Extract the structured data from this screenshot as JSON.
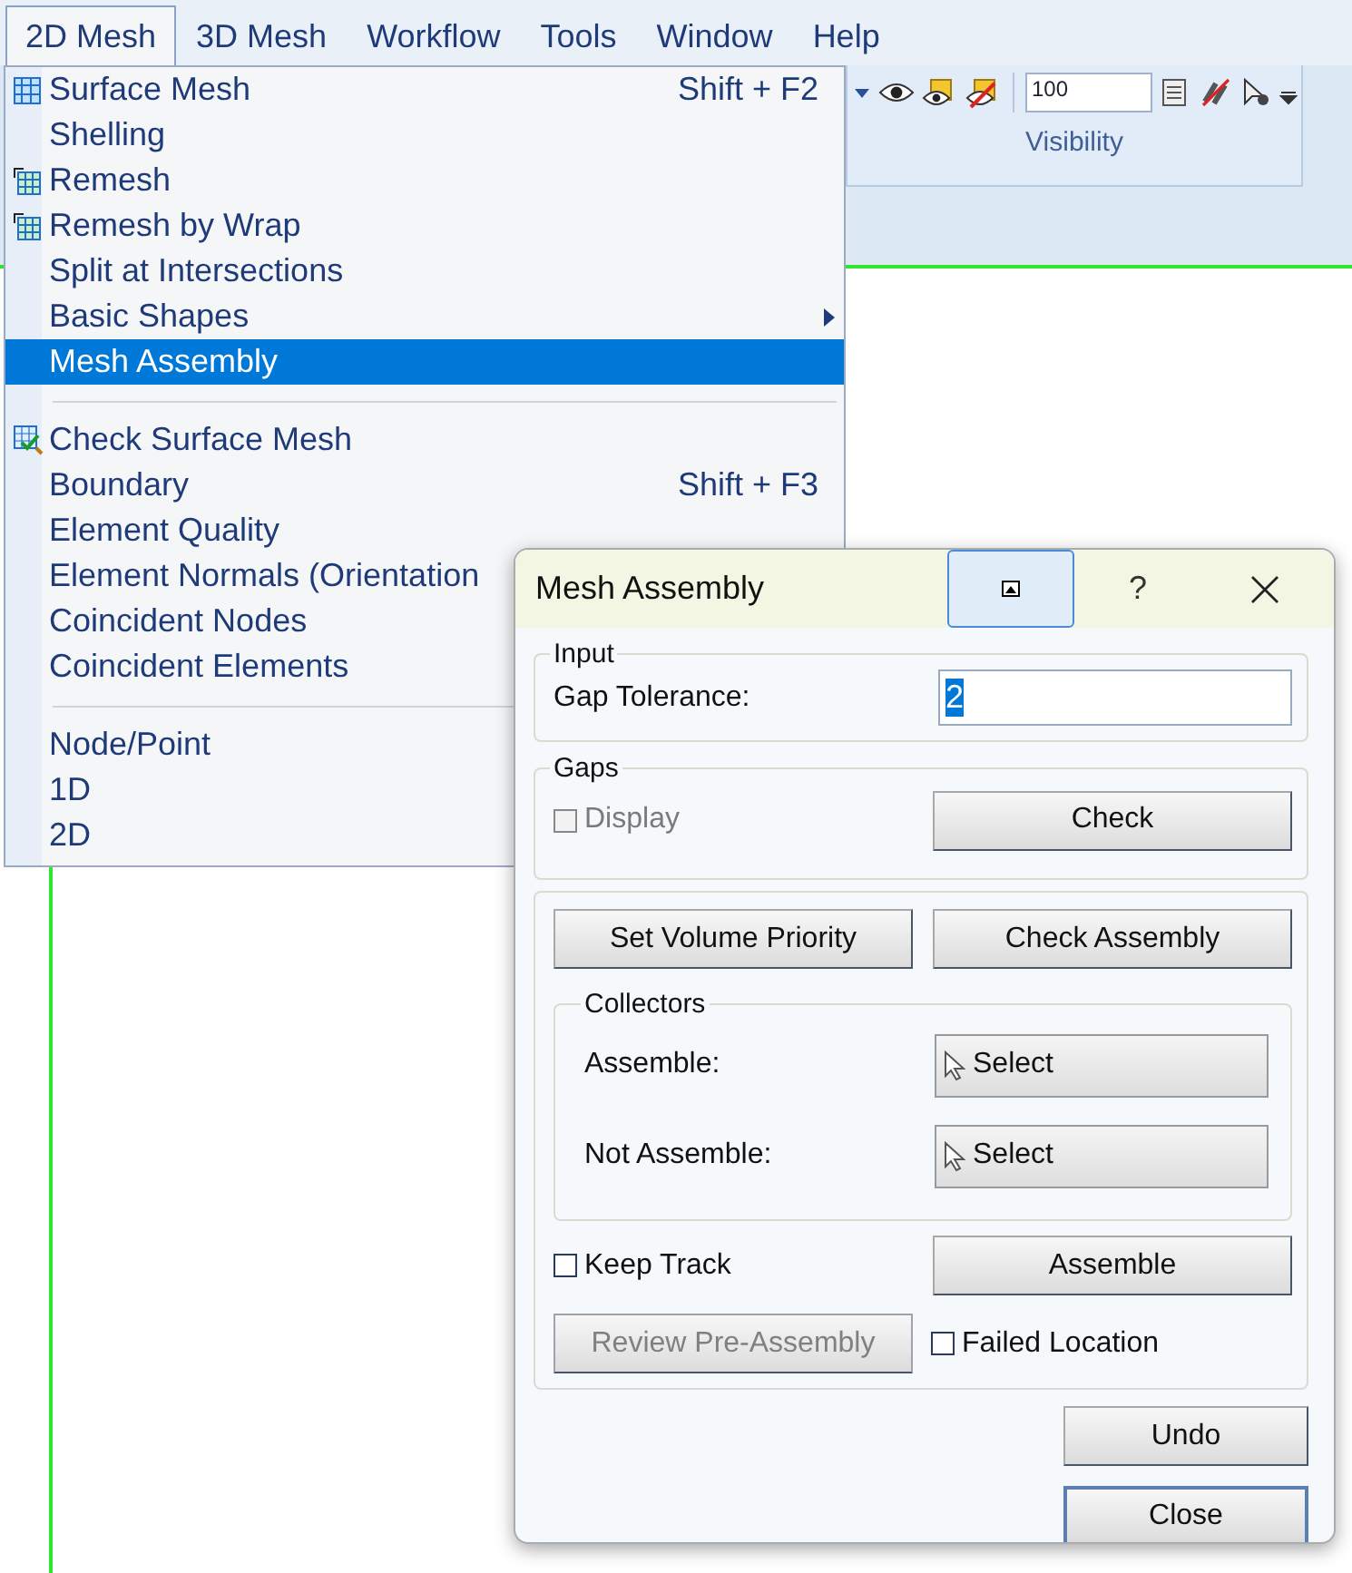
{
  "menubar": [
    {
      "label": "2D Mesh",
      "selected": true
    },
    {
      "label": "3D Mesh",
      "selected": false
    },
    {
      "label": "Workflow",
      "selected": false
    },
    {
      "label": "Tools",
      "selected": false
    },
    {
      "label": "Window",
      "selected": false
    },
    {
      "label": "Help",
      "selected": false
    }
  ],
  "toolbar": {
    "zoom_value": "100",
    "group_label": "Visibility"
  },
  "menu": {
    "items": [
      {
        "kind": "grid",
        "label": "Surface Mesh",
        "shortcut": "Shift + F2",
        "selected": false
      },
      {
        "kind": "plain",
        "label": "Shelling",
        "selected": false
      },
      {
        "kind": "remesh",
        "label": "Remesh",
        "selected": false
      },
      {
        "kind": "remesh",
        "label": "Remesh by Wrap",
        "selected": false
      },
      {
        "kind": "plain",
        "label": "Split at Intersections",
        "selected": false
      },
      {
        "kind": "plain",
        "label": "Basic Shapes",
        "submenu": true,
        "selected": false
      },
      {
        "kind": "plain",
        "label": "Mesh Assembly",
        "selected": true
      },
      {
        "kind": "separator"
      },
      {
        "kind": "check",
        "label": "Check Surface Mesh",
        "selected": false
      },
      {
        "kind": "plain",
        "label": "Boundary",
        "shortcut": "Shift + F3",
        "selected": false
      },
      {
        "kind": "plain",
        "label": "Element Quality",
        "selected": false
      },
      {
        "kind": "plain",
        "label": "Element Normals (Orientation",
        "selected": false
      },
      {
        "kind": "plain",
        "label": "Coincident Nodes",
        "selected": false
      },
      {
        "kind": "plain",
        "label": "Coincident Elements",
        "selected": false
      },
      {
        "kind": "separator"
      },
      {
        "kind": "plain",
        "label": "Node/Point",
        "selected": false
      },
      {
        "kind": "plain",
        "label": "1D",
        "selected": false
      },
      {
        "kind": "plain",
        "label": "2D",
        "selected": false
      }
    ]
  },
  "dialog": {
    "title": "Mesh Assembly",
    "help": "?",
    "input_group": {
      "title": "Input",
      "label": "Gap Tolerance:",
      "value": "2",
      "value_selected": true
    },
    "gaps_group": {
      "title": "Gaps",
      "display": {
        "label": "Display",
        "checked": false,
        "disabled": true
      },
      "button": "Check"
    },
    "assembly_group": {
      "buttons": [
        "Set Volume Priority",
        "Check Assembly"
      ],
      "collectors": {
        "title": "Collectors",
        "rows": [
          {
            "label": "Assemble:",
            "button": "Select"
          },
          {
            "label": "Not Assemble:",
            "button": "Select"
          }
        ]
      },
      "keep_track": {
        "label": "Keep Track",
        "checked": false
      },
      "assemble_button": "Assemble",
      "review_button": {
        "label": "Review Pre-Assembly",
        "disabled": true
      },
      "failed_location": {
        "label": "Failed Location",
        "checked": false
      }
    },
    "undo_button": "Undo",
    "close_button": {
      "label": "Close",
      "focused": true
    }
  }
}
